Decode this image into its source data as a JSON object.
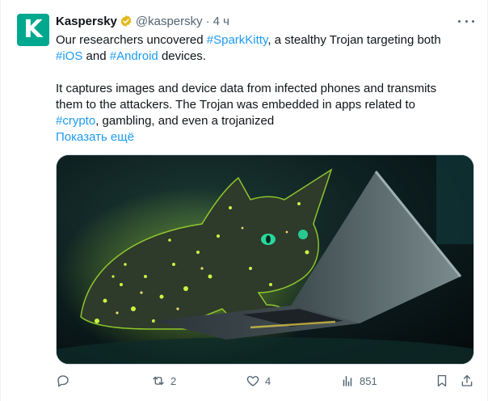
{
  "account": {
    "name": "Kaspersky",
    "handle": "@kaspersky",
    "separator": "·",
    "time": "4 ч",
    "avatar_letter": "K",
    "avatar_color": "#00a88e",
    "verified_badge": "gold-check-badge-icon"
  },
  "post": {
    "line1_a": "Our researchers uncovered ",
    "line1_tag": "#SparkKitty",
    "line1_b": ", a stealthy Trojan targeting both",
    "line2_tag1": "#iOS",
    "line2_mid": " and ",
    "line2_tag2": "#Android",
    "line2_b": " devices.",
    "line3": "It captures images and device data from infected phones and transmits",
    "line4": "them to the attackers. The Trojan was embedded in apps related to",
    "line5_tag": "#crypto",
    "line5_b": ", gambling, and even a trojanized",
    "show_more": "Показать ещё"
  },
  "media": {
    "icon": "glowing-cat-on-laptop-image",
    "accent": "#8fdc2a"
  },
  "actions": {
    "reply_count": "",
    "retweet_count": "2",
    "like_count": "4",
    "views_count": "851"
  },
  "colors": {
    "link": "#1d9bf0",
    "secondary": "#536471",
    "text": "#0f1419"
  }
}
